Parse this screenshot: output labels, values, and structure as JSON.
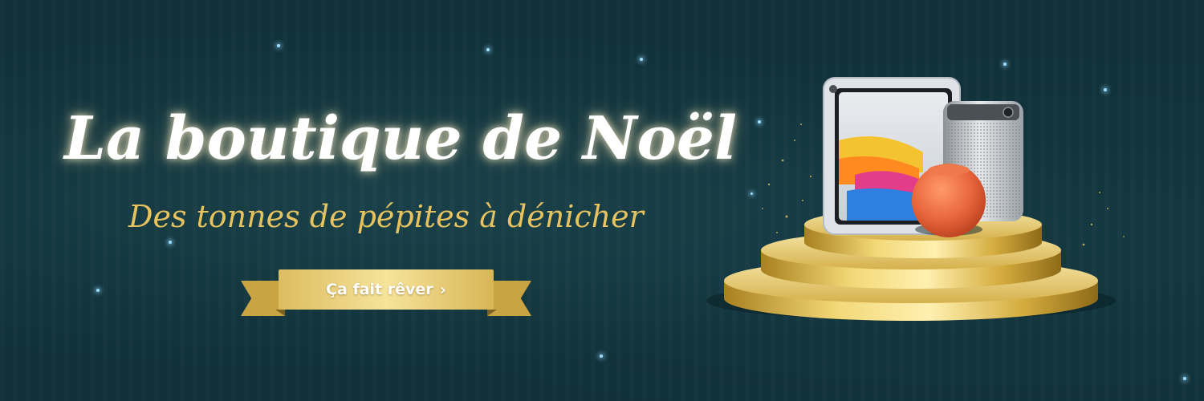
{
  "banner": {
    "title": "La boutique de Noël",
    "subtitle": "Des tonnes de pépites à dénicher",
    "cta": {
      "label": "Ça fait rêver",
      "icon": "chevron-right-icon"
    }
  },
  "colors": {
    "background": "#103139",
    "title": "#ffffff",
    "subtitle_gold": "#e6c35f",
    "ribbon_gold": "#dcbc5f",
    "podium_gold": "#d4ac3e",
    "speaker_orange": "#e8643a"
  },
  "illustration": {
    "icons": [
      "tablet-icon",
      "projector-icon",
      "smart-speaker-icon",
      "podium-icon"
    ]
  }
}
